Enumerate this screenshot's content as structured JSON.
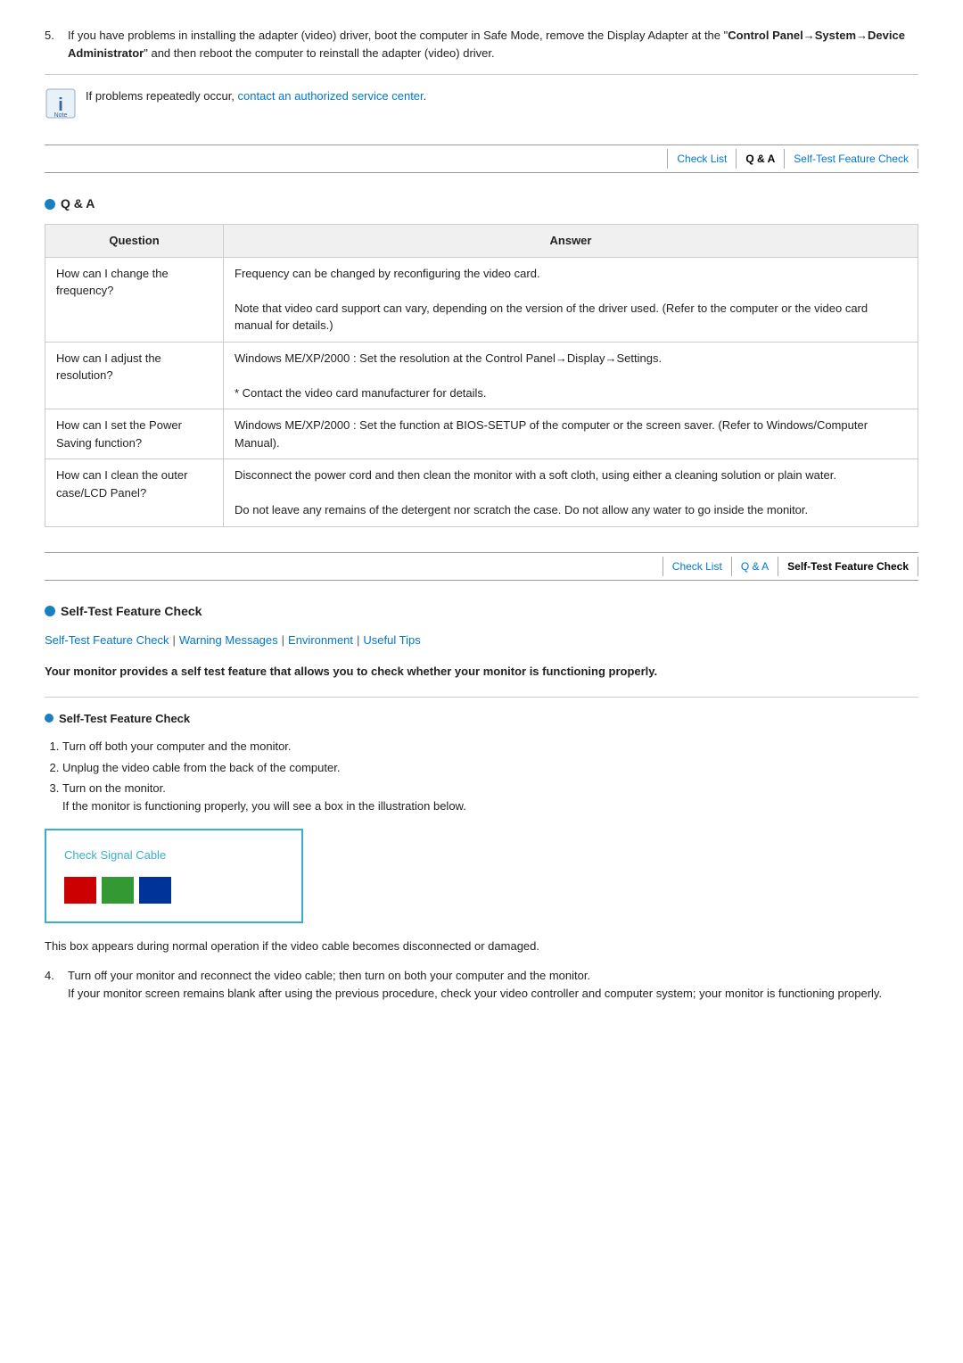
{
  "step5": {
    "number": "5.",
    "text_part1": "If you have problems in installing the adapter (video) driver, boot the computer in Safe Mode, remove the Display Adapter at the \"",
    "bold_text": "Control Panel→System→Device Administrator",
    "text_part2": "\" and then reboot the computer to reinstall the adapter (video) driver."
  },
  "note": {
    "text_before": "If problems repeatedly occur, ",
    "link_text": "contact an authorized service center",
    "text_after": "."
  },
  "nav_top": {
    "items": [
      {
        "label": "Check List",
        "active": false,
        "link": true
      },
      {
        "label": "Q & A",
        "active": true,
        "link": false
      },
      {
        "label": "Self-Test Feature Check",
        "active": false,
        "link": true
      }
    ]
  },
  "qa_section": {
    "title": "Q & A",
    "table": {
      "col_question": "Question",
      "col_answer": "Answer",
      "rows": [
        {
          "question": "How can I change the frequency?",
          "answer": "Frequency can be changed by reconfiguring the video card.\n\nNote that video card support can vary, depending on the version of the driver used. (Refer to the computer or the video card manual for details.)"
        },
        {
          "question": "How can I adjust the resolution?",
          "answer": "Windows ME/XP/2000 : Set the resolution at the Control Panel→Display→Settings.\n\n* Contact the video card manufacturer for details."
        },
        {
          "question": "How can I set the Power Saving function?",
          "answer": "Windows ME/XP/2000 : Set the function at BIOS-SETUP of the computer or the screen saver. (Refer to Windows/Computer Manual)."
        },
        {
          "question": "How can I clean the outer case/LCD Panel?",
          "answer": "Disconnect the power cord and then clean the monitor with a soft cloth, using either a cleaning solution or plain water.\n\nDo not leave any remains of the detergent nor scratch the case. Do not allow any water to go inside the monitor."
        }
      ]
    }
  },
  "nav_bottom": {
    "items": [
      {
        "label": "Check List",
        "active": false
      },
      {
        "label": "Q & A",
        "active": false
      },
      {
        "label": "Self-Test Feature Check",
        "active": true
      }
    ]
  },
  "self_test": {
    "section_title": "Self-Test Feature Check",
    "links": [
      "Self-Test Feature Check",
      "Warning Messages",
      "Environment",
      "Useful Tips"
    ],
    "intro": "Your monitor provides a self test feature that allows you to check whether your monitor is functioning properly.",
    "subtitle": "Self-Test Feature Check",
    "steps": [
      {
        "num": "1.",
        "text": "Turn off both your computer and the monitor."
      },
      {
        "num": "2.",
        "text": "Unplug the video cable from the back of the computer."
      },
      {
        "num": "3.",
        "text": "Turn on the monitor.",
        "sub": "If the monitor is functioning properly, you will see a box in the illustration below."
      }
    ],
    "signal_box": {
      "title": "Check Signal Cable",
      "colors": [
        "red",
        "green",
        "blue"
      ]
    },
    "after_box": "This box appears during normal operation if the video cable becomes disconnected or damaged.",
    "step4": {
      "num": "4.",
      "text": "Turn off your monitor and reconnect the video cable; then turn on both your computer and the monitor.\nIf your monitor screen remains blank after using the previous procedure, check your video controller and computer system; your monitor is functioning properly."
    }
  }
}
